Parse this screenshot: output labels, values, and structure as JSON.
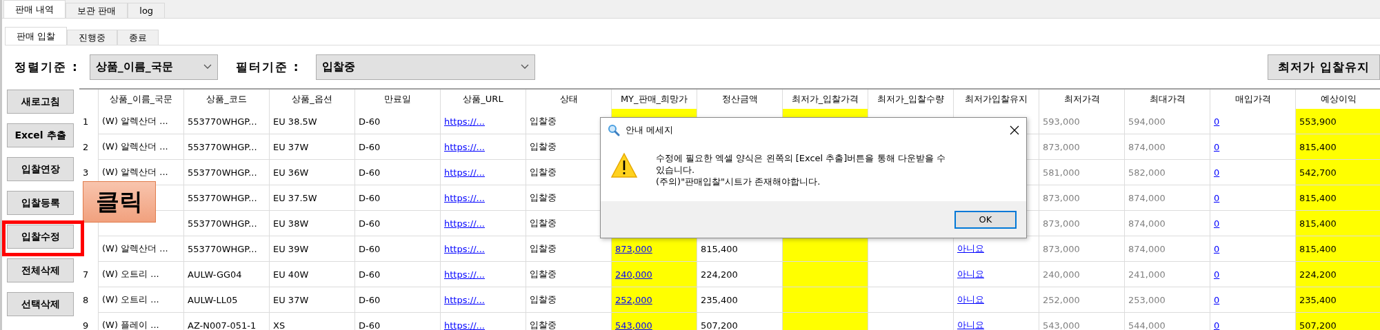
{
  "outer_tabs": [
    {
      "label": "판매 내역",
      "selected": true
    },
    {
      "label": "보관 판매",
      "selected": false
    },
    {
      "label": "log",
      "selected": false
    }
  ],
  "inner_tabs": [
    {
      "label": "판매 입찰",
      "selected": true
    },
    {
      "label": "진행중",
      "selected": false
    },
    {
      "label": "종료",
      "selected": false
    }
  ],
  "toolbar": {
    "sort_label": "정렬기준 :",
    "sort_value": "상품_이름_국문",
    "filter_label": "필터기준 :",
    "filter_value": "입찰중",
    "keep_button": "최저가 입찰유지"
  },
  "side_buttons": [
    {
      "label": "새로고침",
      "highlighted": false
    },
    {
      "label": "Excel 추출",
      "highlighted": false
    },
    {
      "label": "입찰연장",
      "highlighted": false
    },
    {
      "label": "입찰등록",
      "highlighted": false
    },
    {
      "label": "입찰수정",
      "highlighted": true
    },
    {
      "label": "전체삭제",
      "highlighted": false
    },
    {
      "label": "선택삭제",
      "highlighted": false
    }
  ],
  "callout": {
    "text": "클릭"
  },
  "table": {
    "columns": [
      {
        "title": "상품_이름_국문",
        "kind": "text",
        "highlight": false
      },
      {
        "title": "상품_코드",
        "kind": "text",
        "highlight": false
      },
      {
        "title": "상품_옵션",
        "kind": "text",
        "highlight": false
      },
      {
        "title": "만료일",
        "kind": "text",
        "highlight": false
      },
      {
        "title": "상품_URL",
        "kind": "link",
        "highlight": false
      },
      {
        "title": "상태",
        "kind": "text",
        "highlight": false
      },
      {
        "title": "MY_판매_희망가",
        "kind": "link",
        "highlight": true
      },
      {
        "title": "정산금액",
        "kind": "text",
        "highlight": false
      },
      {
        "title": "최저가_입찰가격",
        "kind": "text",
        "highlight": true
      },
      {
        "title": "최저가_입찰수량",
        "kind": "text",
        "highlight": false
      },
      {
        "title": "최저가입찰유지",
        "kind": "link",
        "highlight": false
      },
      {
        "title": "최저가격",
        "kind": "muted",
        "highlight": false
      },
      {
        "title": "최대가격",
        "kind": "muted",
        "highlight": false
      },
      {
        "title": "매입가격",
        "kind": "link",
        "highlight": false
      },
      {
        "title": "예상이익",
        "kind": "text",
        "highlight": true
      }
    ],
    "rows": [
      {
        "index": "1",
        "cells": [
          "(W) 알렉산더 ...",
          "553770WHGP...",
          "EU 38.5W",
          "D-60",
          "https://...",
          "입찰중",
          null,
          null,
          null,
          null,
          null,
          "593,000",
          "594,000",
          "0",
          "553,900"
        ]
      },
      {
        "index": "2",
        "cells": [
          "(W) 알렉산더 ...",
          "553770WHGP...",
          "EU 37W",
          "D-60",
          "https://...",
          "입찰중",
          null,
          null,
          null,
          null,
          null,
          "873,000",
          "874,000",
          "0",
          "815,400"
        ]
      },
      {
        "index": "3",
        "cells": [
          "(W) 알렉산더 ...",
          "553770WHGP...",
          "EU 36W",
          "D-60",
          "https://...",
          "입찰중",
          null,
          null,
          null,
          null,
          null,
          "581,000",
          "582,000",
          "0",
          "542,700"
        ]
      },
      {
        "cells": [
          null,
          "553770WHGP...",
          "EU 37.5W",
          "D-60",
          "https://...",
          "입찰중",
          null,
          null,
          null,
          null,
          null,
          "873,000",
          "874,000",
          "0",
          "815,400"
        ]
      },
      {
        "cells": [
          null,
          "553770WHGP...",
          "EU 38W",
          "D-60",
          "https://...",
          "입찰중",
          null,
          null,
          null,
          null,
          null,
          "873,000",
          "874,000",
          "0",
          "815,400"
        ]
      },
      {
        "cells": [
          "(W) 알렉산더 ...",
          "553770WHGP...",
          "EU 39W",
          "D-60",
          "https://...",
          "입찰중",
          "873,000",
          "815,400",
          null,
          null,
          "아니요",
          "873,000",
          "874,000",
          "0",
          "815,400"
        ]
      },
      {
        "index": "7",
        "cells": [
          "(W) 오트리 ...",
          "AULW-GG04",
          "EU 40W",
          "D-60",
          "https://...",
          "입찰중",
          "240,000",
          "224,200",
          null,
          null,
          "아니요",
          "240,000",
          "241,000",
          "0",
          "224,200"
        ]
      },
      {
        "index": "8",
        "cells": [
          "(W) 오트리 ...",
          "AULW-LL05",
          "EU 37W",
          "D-60",
          "https://...",
          "입찰중",
          "252,000",
          "235,400",
          null,
          null,
          "아니요",
          "252,000",
          "253,000",
          "0",
          "235,400"
        ]
      },
      {
        "index": "9",
        "cells": [
          "(W) 플레이 ...",
          "AZ-N007-051-1",
          "XS",
          "D-60",
          "https://...",
          "입찰중",
          "543,000",
          "507,200",
          null,
          null,
          "아니요",
          "543,000",
          "544,000",
          "0",
          "507,200"
        ]
      }
    ]
  },
  "dialog": {
    "title": "안내 메세지",
    "lines": [
      "수정에 필요한 엑셀 양식은 왼쪽의 [Excel 추출]버튼을 통해 다운받을 수",
      "있습니다.",
      "(주의)\"판매입찰\"시트가 존재해야합니다."
    ],
    "ok": "OK"
  }
}
